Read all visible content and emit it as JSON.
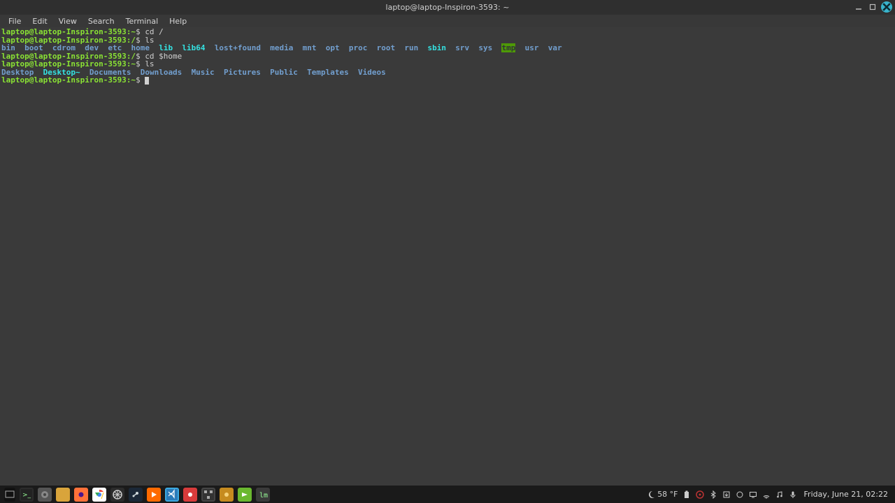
{
  "window": {
    "title": "laptop@laptop-Inspiron-3593: ~"
  },
  "menubar": [
    "File",
    "Edit",
    "View",
    "Search",
    "Terminal",
    "Help"
  ],
  "prompt": {
    "user_host": "laptop@laptop-Inspiron-3593",
    "path_tilde": "~",
    "path_root": "/",
    "sep": ":",
    "dollar": "$"
  },
  "commands": {
    "cd_root": "cd /",
    "ls1": "ls",
    "cd_home": "cd $home",
    "ls2": "ls"
  },
  "root_listing": [
    {
      "name": "bin",
      "style": "dir"
    },
    {
      "name": "boot",
      "style": "dir"
    },
    {
      "name": "cdrom",
      "style": "dir"
    },
    {
      "name": "dev",
      "style": "dir"
    },
    {
      "name": "etc",
      "style": "dir"
    },
    {
      "name": "home",
      "style": "dir"
    },
    {
      "name": "lib",
      "style": "link"
    },
    {
      "name": "lib64",
      "style": "link"
    },
    {
      "name": "lost+found",
      "style": "dir"
    },
    {
      "name": "media",
      "style": "dir"
    },
    {
      "name": "mnt",
      "style": "dir"
    },
    {
      "name": "opt",
      "style": "dir"
    },
    {
      "name": "proc",
      "style": "dir"
    },
    {
      "name": "root",
      "style": "dir"
    },
    {
      "name": "run",
      "style": "dir"
    },
    {
      "name": "sbin",
      "style": "link"
    },
    {
      "name": "srv",
      "style": "dir"
    },
    {
      "name": "sys",
      "style": "dir"
    },
    {
      "name": "tmp",
      "style": "tmp"
    },
    {
      "name": "usr",
      "style": "dir"
    },
    {
      "name": "var",
      "style": "dir"
    }
  ],
  "home_listing": [
    {
      "name": "Desktop",
      "style": "dir"
    },
    {
      "name": "Desktop~",
      "style": "link"
    },
    {
      "name": "Documents",
      "style": "dir"
    },
    {
      "name": "Downloads",
      "style": "dir"
    },
    {
      "name": "Music",
      "style": "dir"
    },
    {
      "name": "Pictures",
      "style": "dir"
    },
    {
      "name": "Public",
      "style": "dir"
    },
    {
      "name": "Templates",
      "style": "dir"
    },
    {
      "name": "Videos",
      "style": "dir"
    }
  ],
  "taskbar": {
    "apps": [
      {
        "name": "terminal",
        "cls": "ic-term"
      },
      {
        "name": "system-settings",
        "cls": "ic-settings"
      },
      {
        "name": "files",
        "cls": "ic-files"
      },
      {
        "name": "firefox",
        "cls": "ic-firefox"
      },
      {
        "name": "chrome",
        "cls": "ic-chrome"
      },
      {
        "name": "wheel",
        "cls": "ic-wheel"
      },
      {
        "name": "steam",
        "cls": "ic-steam"
      },
      {
        "name": "media-player",
        "cls": "ic-play"
      },
      {
        "name": "vscode",
        "cls": "ic-vscode"
      },
      {
        "name": "red-app",
        "cls": "ic-red"
      },
      {
        "name": "jetbrains",
        "cls": "ic-pattern"
      },
      {
        "name": "gold-app",
        "cls": "ic-gold"
      },
      {
        "name": "green-app",
        "cls": "ic-green"
      },
      {
        "name": "mint-menu",
        "cls": "ic-mint"
      }
    ],
    "weather_temp": "58 °F",
    "clock": "Friday, June 21, 02:22"
  }
}
